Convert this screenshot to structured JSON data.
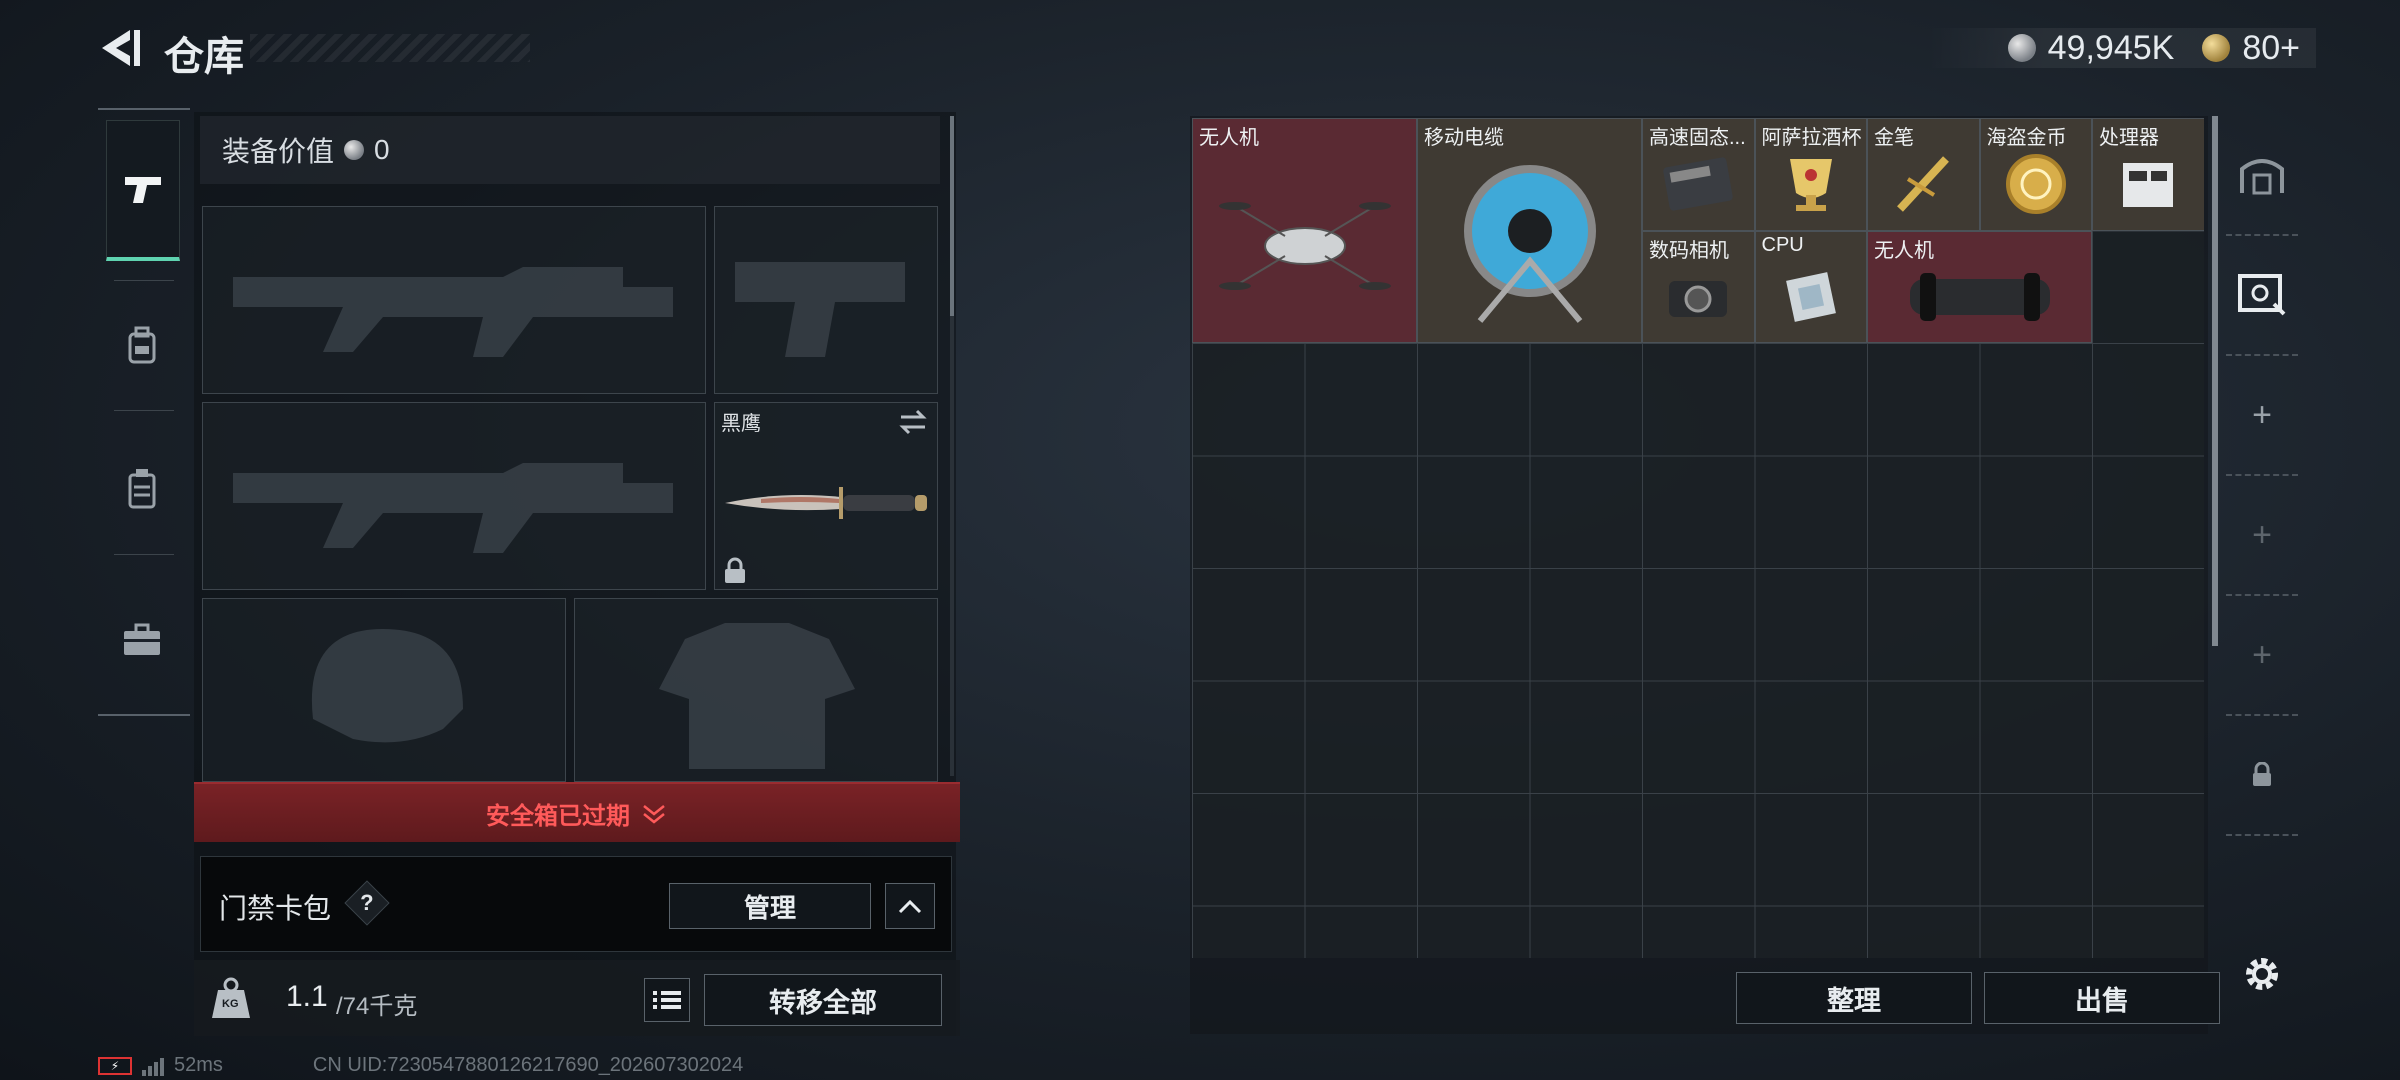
{
  "header": {
    "title": "仓库",
    "currency_silver": "49,945K",
    "currency_gold": "80+"
  },
  "left_tabs": [
    {
      "name": "weapons",
      "icon": "pistol-icon",
      "active": true
    },
    {
      "name": "armor",
      "icon": "backpack-icon",
      "active": false
    },
    {
      "name": "chest-rig",
      "icon": "vest-icon",
      "active": false
    },
    {
      "name": "case",
      "icon": "briefcase-icon",
      "active": false
    }
  ],
  "equipment": {
    "value_label": "装备价值",
    "value": "0",
    "melee_label": "黑鹰",
    "safe_box_status": "安全箱已过期"
  },
  "keycard": {
    "label": "门禁卡包",
    "help": "?",
    "manage_label": "管理"
  },
  "weight": {
    "unit_badge": "KG",
    "current": "1.1",
    "capacity": "/74千克",
    "transfer_all_label": "转移全部"
  },
  "storage": {
    "items": [
      {
        "id": "drone-1",
        "label": "无人机",
        "col": 0,
        "row": 0,
        "w": 2,
        "h": 2,
        "bg": "#5a2a33"
      },
      {
        "id": "cable-reel",
        "label": "移动电缆",
        "col": 2,
        "row": 0,
        "w": 2,
        "h": 2,
        "bg": "#3f3a33"
      },
      {
        "id": "ssd",
        "label": "高速固态...",
        "col": 4,
        "row": 0,
        "w": 1,
        "h": 1,
        "bg": "#3f3a33"
      },
      {
        "id": "cup",
        "label": "阿萨拉酒杯",
        "col": 5,
        "row": 0,
        "w": 1,
        "h": 1,
        "bg": "#3f3a33"
      },
      {
        "id": "gold-pen",
        "label": "金笔",
        "col": 6,
        "row": 0,
        "w": 1,
        "h": 1,
        "bg": "#3f3a33"
      },
      {
        "id": "pirate-coin",
        "label": "海盗金币",
        "col": 7,
        "row": 0,
        "w": 1,
        "h": 1,
        "bg": "#3f3a33"
      },
      {
        "id": "processor",
        "label": "处理器",
        "col": 8,
        "row": 0,
        "w": 1,
        "h": 1,
        "bg": "#3f3a33"
      },
      {
        "id": "camera",
        "label": "数码相机",
        "col": 4,
        "row": 1,
        "w": 1,
        "h": 1,
        "bg": "#3f3a33"
      },
      {
        "id": "cpu",
        "label": "CPU",
        "col": 5,
        "row": 1,
        "w": 1,
        "h": 1,
        "bg": "#3f3a33"
      },
      {
        "id": "drone-2",
        "label": "无人机",
        "col": 6,
        "row": 1,
        "w": 2,
        "h": 1,
        "bg": "#5a2a33"
      }
    ],
    "sort_label": "整理",
    "sell_label": "出售"
  },
  "footer": {
    "ping": "52ms",
    "uid": "CN UID:7230547880126217690_202607302024"
  }
}
